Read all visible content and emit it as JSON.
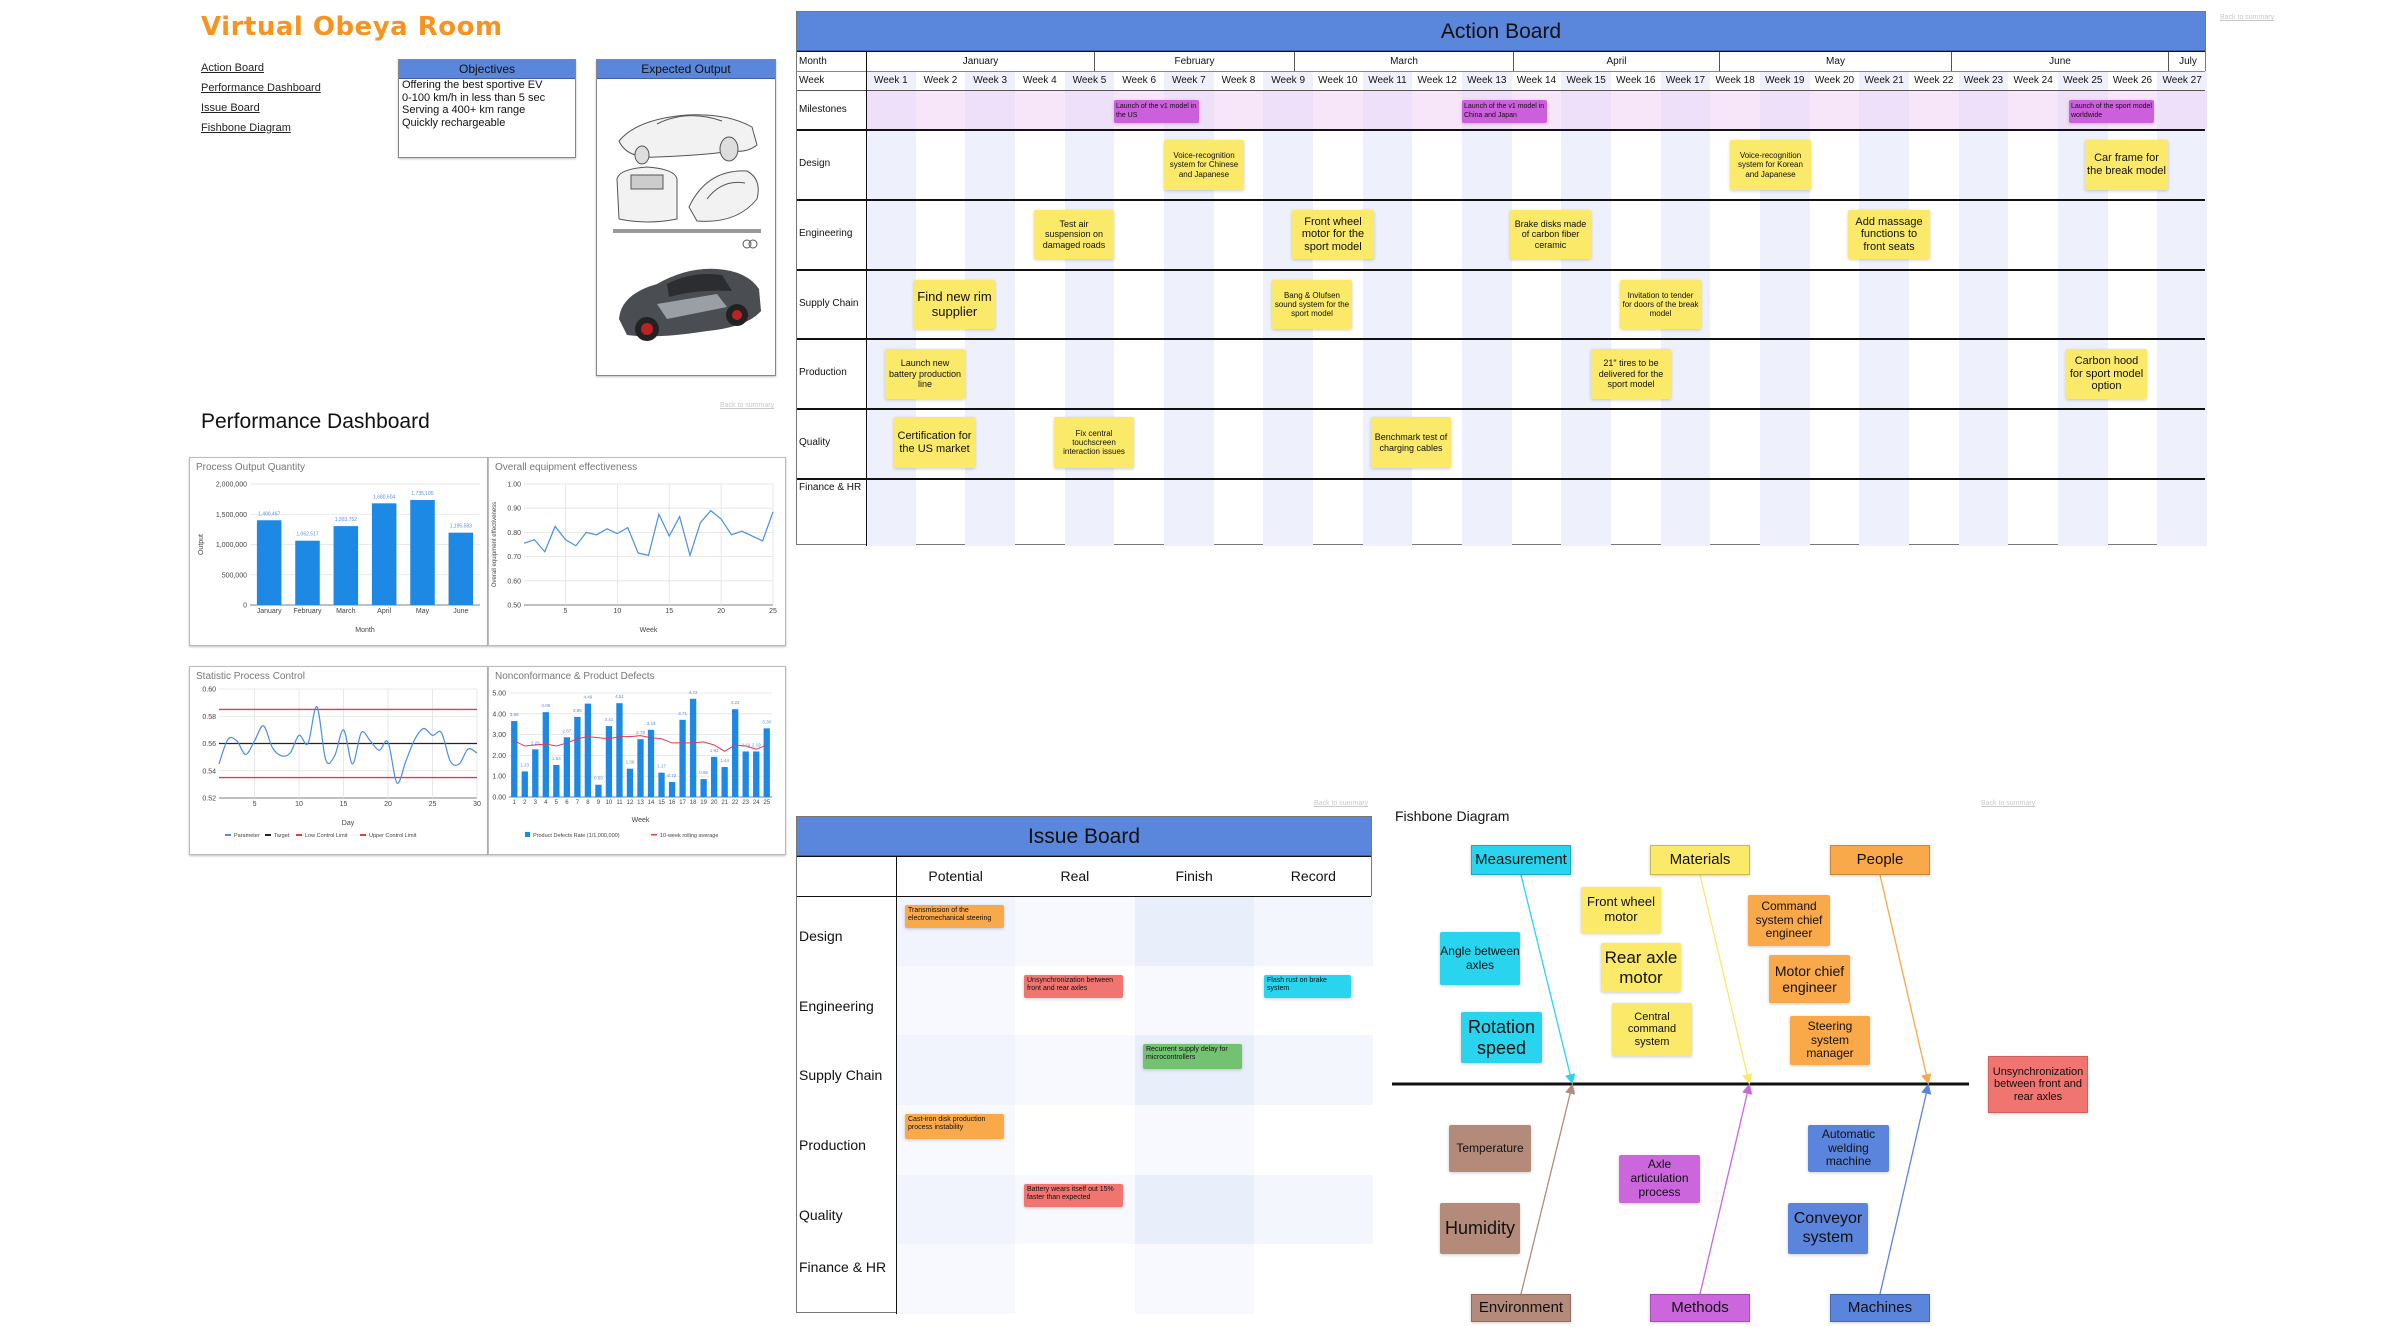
{
  "app_title": "Virtual Obeya Room",
  "nav": [
    "Action Board",
    "Performance Dashboard",
    "Issue Board",
    "Fishbone Diagram"
  ],
  "back_link": "Back to summary",
  "objectives": {
    "title": "Objectives",
    "lines": [
      "Offering the best sportive EV",
      "0-100 km/h in less than 5 sec",
      "Serving a 400+ km range",
      "Quickly rechargeable"
    ]
  },
  "expected_output": {
    "title": "Expected Output",
    "images": [
      "car-sketch-image",
      "car-cutaway-image"
    ]
  },
  "performance_dashboard": {
    "title": "Performance Dashboard"
  },
  "chart_data": [
    {
      "type": "bar",
      "title": "Process Output Quantity",
      "xlabel": "Month",
      "ylabel": "Output",
      "categories": [
        "January",
        "February",
        "March",
        "April",
        "May",
        "June"
      ],
      "values": [
        1400467,
        1062517,
        1303752,
        1680604,
        1735105,
        1195583
      ],
      "data_labels": [
        "1,400,467",
        "1,062,517",
        "1,303,752",
        "1,680,604",
        "1,735,105",
        "1,195,583"
      ],
      "ylim": [
        0,
        2000000
      ],
      "yticks": [
        "0",
        "500,000",
        "1,000,000",
        "1,500,000",
        "2,000,000"
      ],
      "grid": true,
      "color": "#1e88e5"
    },
    {
      "type": "line",
      "title": "Overall equipment effectiveness",
      "xlabel": "Week",
      "ylabel": "Overall equipment effectiveness",
      "x": [
        1,
        2,
        3,
        4,
        5,
        6,
        7,
        8,
        9,
        10,
        11,
        12,
        13,
        14,
        15,
        16,
        17,
        18,
        19,
        20,
        21,
        22,
        23,
        24,
        25
      ],
      "values": [
        0.755,
        0.77,
        0.72,
        0.825,
        0.77,
        0.745,
        0.8,
        0.79,
        0.815,
        0.795,
        0.82,
        0.715,
        0.705,
        0.875,
        0.785,
        0.865,
        0.705,
        0.84,
        0.89,
        0.855,
        0.79,
        0.805,
        0.785,
        0.765,
        0.885
      ],
      "ylim": [
        0.5,
        1.0
      ],
      "yticks": [
        "0.50",
        "0.60",
        "0.70",
        "0.80",
        "0.90",
        "1.00"
      ],
      "xticks": [
        "5",
        "10",
        "15",
        "20",
        "25"
      ],
      "grid": true,
      "color": "#4a8fe0"
    },
    {
      "type": "line",
      "title": "Statistic Process Control",
      "xlabel": "Day",
      "x": [
        1,
        2,
        3,
        4,
        5,
        6,
        7,
        8,
        9,
        10,
        11,
        12,
        13,
        14,
        15,
        16,
        17,
        18,
        19,
        20,
        21,
        22,
        23,
        24,
        25,
        26,
        27,
        28,
        29,
        30
      ],
      "series": [
        {
          "name": "Parameter",
          "color": "#4a8fe0",
          "values": [
            0.545,
            0.563,
            0.562,
            0.552,
            0.562,
            0.573,
            0.557,
            0.551,
            0.553,
            0.566,
            0.56,
            0.587,
            0.548,
            0.551,
            0.57,
            0.545,
            0.568,
            0.562,
            0.555,
            0.561,
            0.531,
            0.547,
            0.563,
            0.571,
            0.566,
            0.568,
            0.547,
            0.545,
            0.556,
            0.553
          ]
        },
        {
          "name": "Target",
          "color": "#222222",
          "value": 0.56
        },
        {
          "name": "Low Control Limit",
          "color": "#e53950",
          "value": 0.535
        },
        {
          "name": "Upper Control Limit",
          "color": "#e53950",
          "value": 0.585
        }
      ],
      "ylim": [
        0.52,
        0.6
      ],
      "yticks": [
        "0.52",
        "0.54",
        "0.56",
        "0.58",
        "0.60"
      ],
      "xticks": [
        "5",
        "10",
        "15",
        "20",
        "25",
        "30"
      ],
      "grid": true,
      "legend": "bottom"
    },
    {
      "type": "bar",
      "title": "Nonconformance & Product Defects",
      "xlabel": "Week",
      "categories": [
        "1",
        "2",
        "3",
        "4",
        "5",
        "6",
        "7",
        "8",
        "9",
        "10",
        "11",
        "12",
        "13",
        "14",
        "15",
        "16",
        "17",
        "18",
        "19",
        "20",
        "21",
        "22",
        "23",
        "24",
        "25"
      ],
      "series": [
        {
          "name": "Product Defects Rate (1/1,000,000)",
          "type": "bar",
          "color": "#1e88e5",
          "values": [
            3.65,
            1.23,
            2.29,
            4.08,
            1.54,
            2.87,
            3.85,
            4.49,
            0.59,
            3.41,
            4.51,
            1.36,
            2.78,
            3.23,
            1.17,
            0.72,
            3.71,
            4.72,
            0.86,
            1.93,
            1.44,
            4.22,
            2.19,
            2.19,
            3.3
          ],
          "data_labels": [
            "3.65",
            "1.23",
            "2.29",
            "4.08",
            "1.54",
            "2.87",
            "3.85",
            "4.49",
            "0.59",
            "3.41",
            "4.51",
            "1.36",
            "2.78",
            "3.23",
            "1.17",
            "0.72",
            "3.71",
            "4.72",
            "0.86",
            "1.93",
            "1.44",
            "4.22",
            "2.19",
            "2.19",
            "3.30"
          ]
        },
        {
          "name": "10-week rolling average",
          "type": "line",
          "color": "#e53950",
          "values": [
            2.7,
            2.45,
            2.5,
            2.55,
            2.45,
            2.6,
            2.8,
            2.9,
            2.85,
            2.8,
            2.9,
            2.9,
            2.95,
            2.85,
            2.8,
            2.6,
            2.6,
            2.6,
            2.65,
            2.5,
            2.2,
            2.5,
            2.45,
            2.3,
            2.5
          ]
        }
      ],
      "ylim": [
        0,
        5
      ],
      "yticks": [
        "0.00",
        "1.00",
        "2.00",
        "3.00",
        "4.00",
        "5.00"
      ],
      "grid": true,
      "legend": "bottom"
    }
  ],
  "action_board": {
    "title": "Action Board",
    "month_label": "Month",
    "week_label": "Week",
    "months": [
      "January",
      "February",
      "March",
      "April",
      "May",
      "June",
      "July"
    ],
    "weeks": [
      "Week 1",
      "Week 2",
      "Week 3",
      "Week 4",
      "Week 5",
      "Week 6",
      "Week 7",
      "Week 8",
      "Week 9",
      "Week 10",
      "Week 11",
      "Week 12",
      "Week 13",
      "Week 14",
      "Week 15",
      "Week 16",
      "Week 17",
      "Week 18",
      "Week 19",
      "Week 20",
      "Week 21",
      "Week 22",
      "Week 23",
      "Week 24",
      "Week 25",
      "Week 26",
      "Week 27"
    ],
    "rows": [
      "Milestones",
      "Design",
      "Engineering",
      "Supply Chain",
      "Production",
      "Quality",
      "Finance & HR"
    ],
    "cards": [
      {
        "row": "Milestones",
        "text": "Launch of the v1 model in the US",
        "color": "#cc5fdc"
      },
      {
        "row": "Milestones",
        "text": "Launch of the v1 model in China and Japan",
        "color": "#cc5fdc"
      },
      {
        "row": "Milestones",
        "text": "Launch of the sport model worldwide",
        "color": "#cc5fdc"
      },
      {
        "row": "Design",
        "text": "Voice-recognition system for Chinese and Japanese",
        "color": "#fbe96a"
      },
      {
        "row": "Design",
        "text": "Voice-recognition system for Korean and Japanese",
        "color": "#fbe96a"
      },
      {
        "row": "Design",
        "text": "Car frame for the break model",
        "color": "#fbe96a"
      },
      {
        "row": "Engineering",
        "text": "Test air suspension on damaged roads",
        "color": "#fbe96a"
      },
      {
        "row": "Engineering",
        "text": "Front wheel motor for the sport model",
        "color": "#fbe96a"
      },
      {
        "row": "Engineering",
        "text": "Brake disks made of carbon fiber ceramic",
        "color": "#fbe96a"
      },
      {
        "row": "Engineering",
        "text": "Add massage functions to front seats",
        "color": "#fbe96a"
      },
      {
        "row": "Supply Chain",
        "text": "Find new rim supplier",
        "color": "#fbe96a"
      },
      {
        "row": "Supply Chain",
        "text": "Bang & Olufsen sound system for the sport model",
        "color": "#fbe96a"
      },
      {
        "row": "Supply Chain",
        "text": "Invitation to tender for doors of the break model",
        "color": "#fbe96a"
      },
      {
        "row": "Production",
        "text": "Launch new battery production line",
        "color": "#fbe96a"
      },
      {
        "row": "Production",
        "text": "21\" tires to be delivered for the sport model",
        "color": "#fbe96a"
      },
      {
        "row": "Production",
        "text": "Carbon hood for sport model option",
        "color": "#fbe96a"
      },
      {
        "row": "Quality",
        "text": "Certification for the US market",
        "color": "#fbe96a"
      },
      {
        "row": "Quality",
        "text": "Fix central touchscreen interaction issues",
        "color": "#fbe96a"
      },
      {
        "row": "Quality",
        "text": "Benchmark test of charging cables",
        "color": "#fbe96a"
      }
    ]
  },
  "issue_board": {
    "title": "Issue Board",
    "columns": [
      "Potential",
      "Real",
      "Finish",
      "Record"
    ],
    "rows": [
      "Design",
      "Engineering",
      "Supply Chain",
      "Production",
      "Quality",
      "Finance & HR"
    ],
    "cards": [
      {
        "row": "Design",
        "column": "Potential",
        "text": "Transmission of the electromechanical steering",
        "color": "#f9a84a"
      },
      {
        "row": "Engineering",
        "column": "Real",
        "text": "Unsynchronization between front and rear axles",
        "color": "#f07470"
      },
      {
        "row": "Engineering",
        "column": "Record",
        "text": "Flash rust on brake system",
        "color": "#29d4ee"
      },
      {
        "row": "Supply Chain",
        "column": "Finish",
        "text": "Recurrent supply delay for microcontrollers",
        "color": "#72c271"
      },
      {
        "row": "Production",
        "column": "Potential",
        "text": "Cast-iron disk production process instability",
        "color": "#f9a84a"
      },
      {
        "row": "Quality",
        "column": "Real",
        "text": "Battery wears itself out 15% faster than expected",
        "color": "#f07470"
      }
    ]
  },
  "fishbone": {
    "title": "Fishbone Diagram",
    "effect": {
      "text": "Unsynchronization between front and rear axles",
      "color": "#f07470"
    },
    "categories": [
      {
        "name": "Measurement",
        "color": "#29d4ee",
        "causes": [
          "Angle between axles",
          "Rotation speed"
        ]
      },
      {
        "name": "Materials",
        "color": "#fbe96a",
        "causes": [
          "Front wheel motor",
          "Rear axle motor",
          "Central command system"
        ]
      },
      {
        "name": "People",
        "color": "#f9a84a",
        "causes": [
          "Command system chief engineer",
          "Motor chief engineer",
          "Steering system manager"
        ]
      },
      {
        "name": "Environment",
        "color": "#b48a7a",
        "causes": [
          "Temperature",
          "Humidity"
        ]
      },
      {
        "name": "Methods",
        "color": "#cc66dd",
        "causes": [
          "Axle articulation process"
        ]
      },
      {
        "name": "Machines",
        "color": "#5b85dd",
        "causes": [
          "Automatic welding machine",
          "Conveyor system"
        ]
      }
    ]
  }
}
